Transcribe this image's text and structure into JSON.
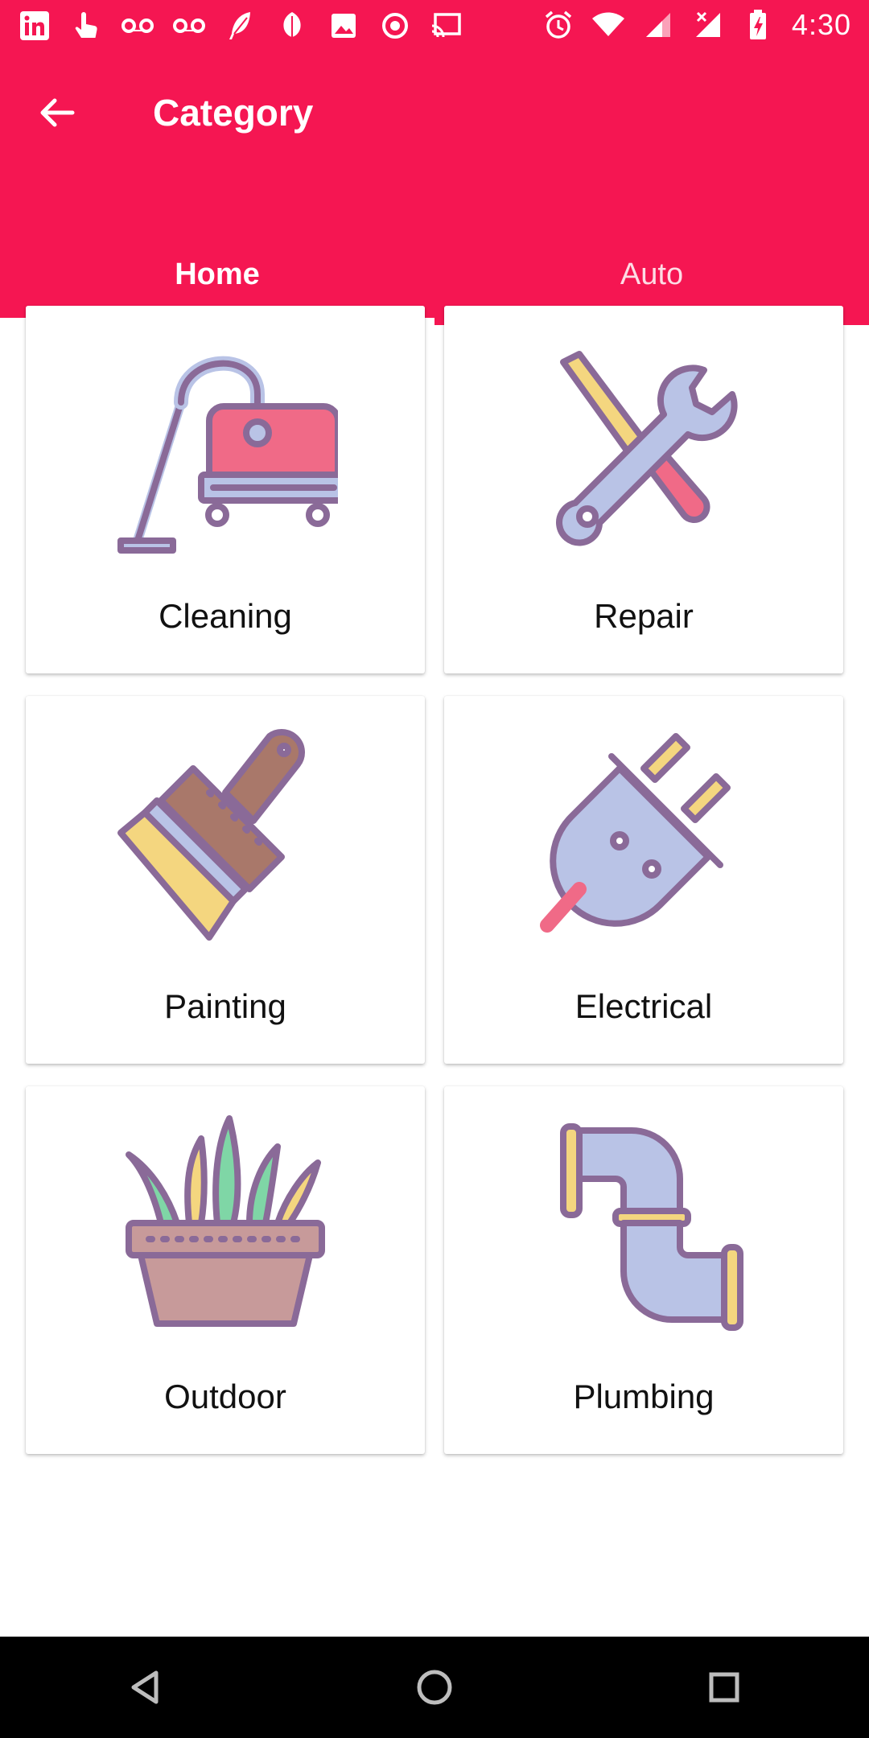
{
  "status_bar": {
    "time": "4:30",
    "left_icons": [
      "linkedin-icon",
      "touch-icon",
      "voicemail-icon",
      "voicemail-icon",
      "feather-icon",
      "leaf-icon",
      "image-icon",
      "record-icon",
      "cast-icon"
    ],
    "right_icons": [
      "alarm-icon",
      "wifi-icon",
      "signal-icon",
      "signal-off-icon",
      "battery-charging-icon"
    ]
  },
  "app_bar": {
    "title": "Category"
  },
  "tabs": [
    {
      "label": "Home",
      "active": true
    },
    {
      "label": "Auto",
      "active": false
    }
  ],
  "categories": [
    {
      "label": "Cleaning",
      "icon": "vacuum-cleaner-icon"
    },
    {
      "label": "Repair",
      "icon": "wrench-screwdriver-icon"
    },
    {
      "label": "Painting",
      "icon": "paint-brush-icon"
    },
    {
      "label": "Electrical",
      "icon": "electric-plug-icon"
    },
    {
      "label": "Outdoor",
      "icon": "potted-grass-icon"
    },
    {
      "label": "Plumbing",
      "icon": "pipe-icon"
    }
  ],
  "colors": {
    "accent": "#f51652",
    "outline": "#8a6a98",
    "pink": "#f06a87",
    "lavender": "#b9c3e6",
    "yellow": "#f4d67f"
  }
}
